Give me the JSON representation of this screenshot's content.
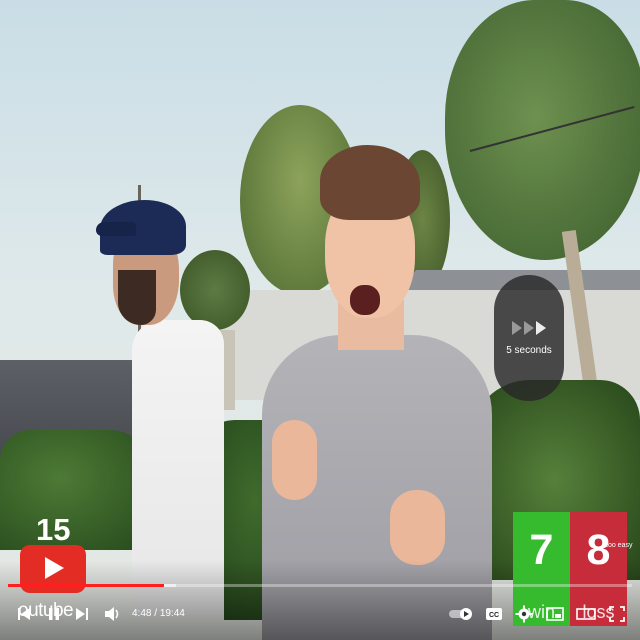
{
  "player": {
    "seek_indicator": {
      "label": "5 seconds"
    },
    "time": {
      "current": "4:48",
      "duration": "19:44",
      "separator": "/"
    },
    "progress": 0.25,
    "buffered": 0.27,
    "colors": {
      "progress": "#ff1f1f",
      "win": "#36bb2f",
      "loss": "#c62c3a",
      "youtube_red": "#e22c24"
    },
    "controls": {
      "previous": "previous-icon",
      "pause": "pause-icon",
      "next": "next-icon",
      "volume": "volume-icon",
      "autoplay": "autoplay-toggle",
      "captions": "CC",
      "settings": "gear-icon",
      "miniplayer": "miniplayer-icon",
      "theater": "theater-icon",
      "fullscreen": "fullscreen-icon"
    }
  },
  "overlay": {
    "subscriber_badge": {
      "count": "15",
      "word": "outube"
    },
    "scoreboard": {
      "win": {
        "value": "7",
        "label": "win"
      },
      "loss": {
        "value": "8",
        "label": "loss"
      },
      "note": "too easy"
    }
  }
}
